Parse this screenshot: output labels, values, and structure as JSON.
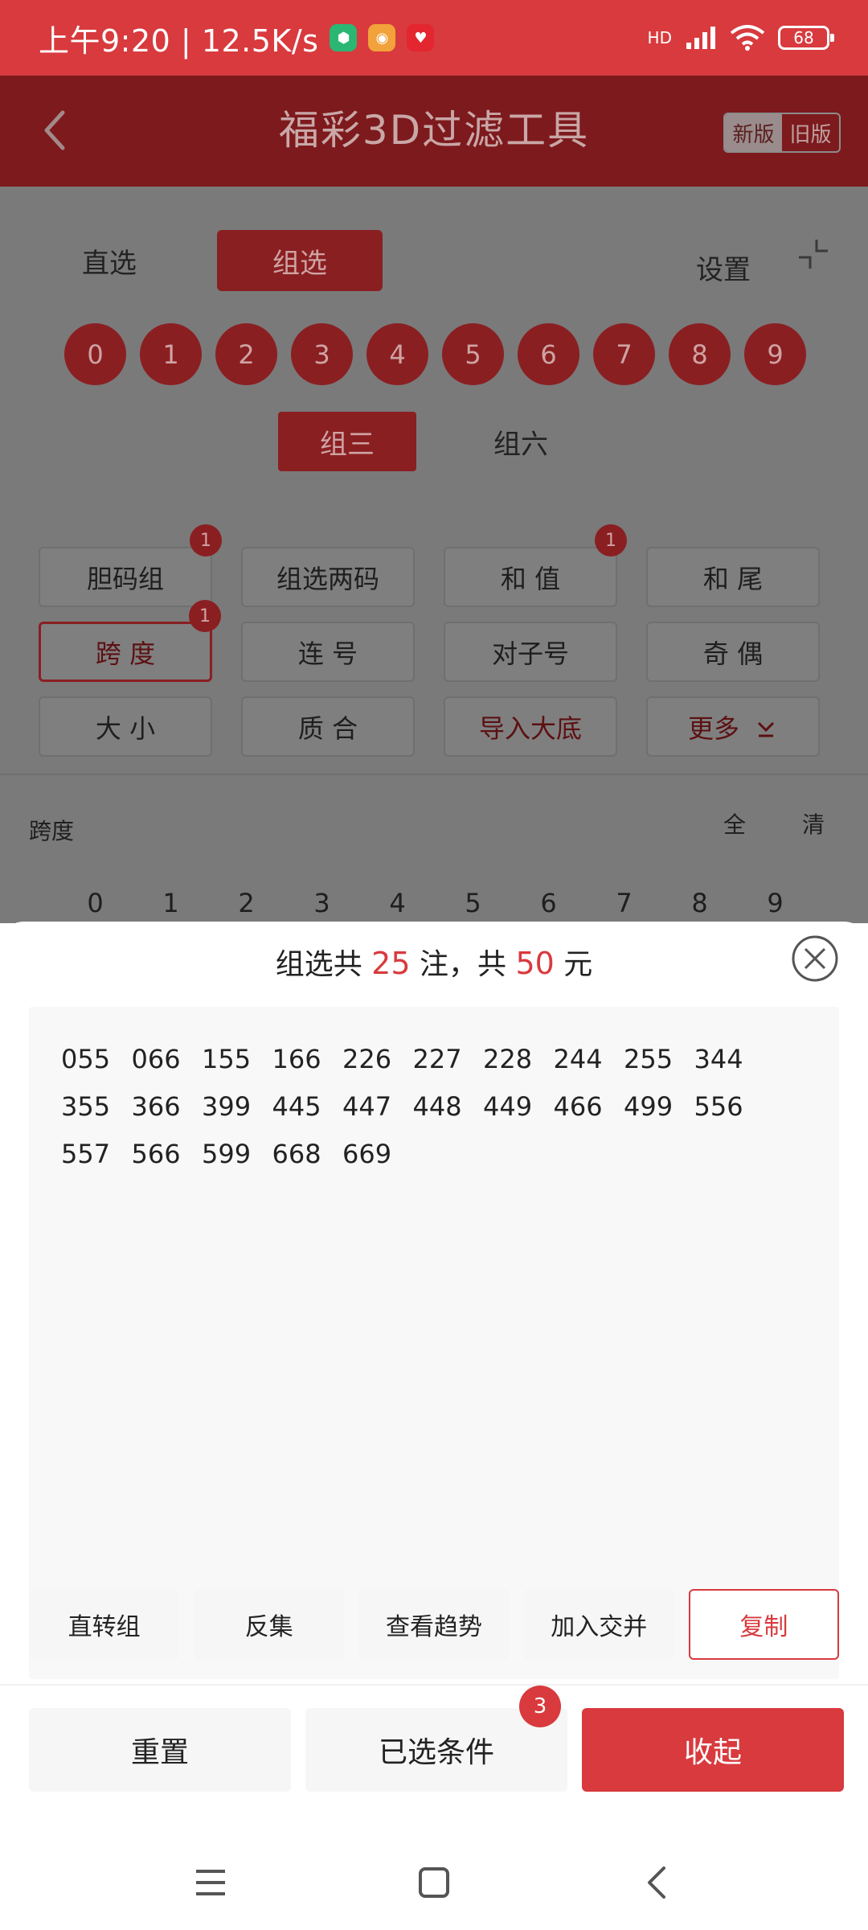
{
  "status_bar": {
    "time": "上午9:20 | 12.5K/s",
    "network": "HD",
    "battery": "68"
  },
  "header": {
    "title": "福彩3D过滤工具",
    "version_new": "新版",
    "version_old": "旧版"
  },
  "mode_tabs": {
    "direct": "直选",
    "group": "组选",
    "settings": "设置"
  },
  "digits": [
    "0",
    "1",
    "2",
    "3",
    "4",
    "5",
    "6",
    "7",
    "8",
    "9"
  ],
  "sub_tabs": {
    "group3": "组三",
    "group6": "组六"
  },
  "filters": [
    {
      "label": "胆码组",
      "badge": "1"
    },
    {
      "label": "组选两码"
    },
    {
      "label": "和 值",
      "badge": "1"
    },
    {
      "label": "和 尾"
    },
    {
      "label": "跨 度",
      "badge": "1",
      "active": true
    },
    {
      "label": "连 号"
    },
    {
      "label": "对子号"
    },
    {
      "label": "奇 偶"
    },
    {
      "label": "大 小"
    },
    {
      "label": "质 合"
    },
    {
      "label": "导入大底",
      "accent": true
    },
    {
      "label": "更多",
      "accent": true,
      "more": true
    }
  ],
  "span_section": {
    "label": "跨度",
    "select_all": "全",
    "clear": "清",
    "digits": [
      "0",
      "1",
      "2",
      "3",
      "4",
      "5",
      "6",
      "7",
      "8",
      "9"
    ]
  },
  "sheet": {
    "summary_prefix": "组选共",
    "count": "25",
    "summary_mid": "注，共",
    "amount": "50",
    "summary_suffix": "元",
    "results": [
      "055",
      "066",
      "155",
      "166",
      "226",
      "227",
      "228",
      "244",
      "255",
      "344",
      "355",
      "366",
      "399",
      "445",
      "447",
      "448",
      "449",
      "466",
      "499",
      "556",
      "557",
      "566",
      "599",
      "668",
      "669"
    ],
    "actions": [
      "直转组",
      "反集",
      "查看趋势",
      "加入交并",
      "复制"
    ],
    "reset": "重置",
    "conditions": "已选条件",
    "conditions_badge": "3",
    "collapse": "收起"
  },
  "colors": {
    "primary": "#d83a3e",
    "header_dim": "#7d1a1d",
    "overlay": "#7a7a7a"
  }
}
